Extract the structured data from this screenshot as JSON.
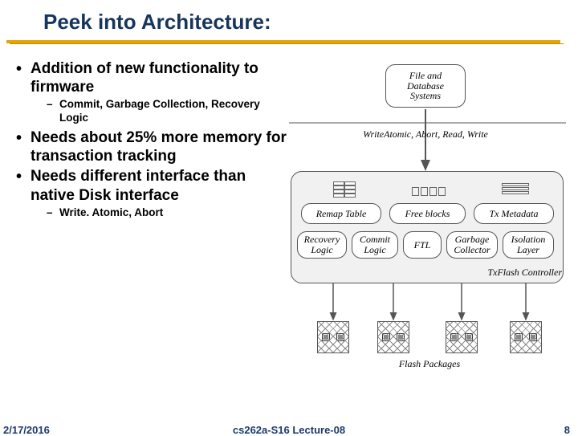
{
  "title": "Peek into Architecture:",
  "bullets": {
    "b1": "Addition of new functionality to firmware",
    "b1a": "Commit, Garbage Collection, Recovery Logic",
    "b2": "Needs about 25% more memory for transaction tracking",
    "b3": "Needs different interface than native Disk interface",
    "b3a": "Write. Atomic, Abort"
  },
  "diagram": {
    "top_box": "File and\nDatabase\nSystems",
    "iface_label": "WriteAtomic, Abort, Read, Write",
    "remap": "Remap Table",
    "freeblocks": "Free blocks",
    "txmeta": "Tx Metadata",
    "recovery": "Recovery\nLogic",
    "commit": "Commit\nLogic",
    "ftl": "FTL",
    "gc": "Garbage\nCollector",
    "isolation": "Isolation\nLayer",
    "controller": "TxFlash Controller",
    "flashpkg": "Flash Packages"
  },
  "footer": {
    "date": "2/17/2016",
    "mid": "cs262a-S16 Lecture-08",
    "page": "8"
  }
}
